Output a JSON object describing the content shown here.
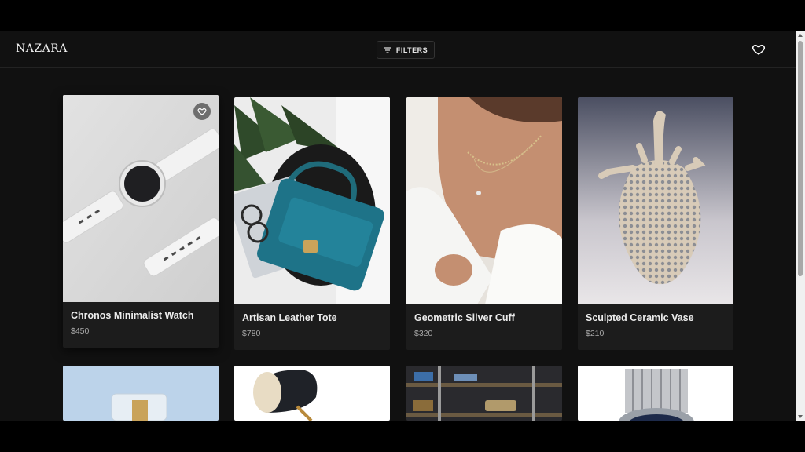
{
  "header": {
    "brand": "NAZARA",
    "filters_label": "FILTERS"
  },
  "products": [
    {
      "name": "Chronos Minimalist Watch",
      "price": "$450",
      "image": "white-smartwatch"
    },
    {
      "name": "Artisan Leather Tote",
      "price": "$780",
      "image": "teal-leather-handbag"
    },
    {
      "name": "Geometric Silver Cuff",
      "price": "$320",
      "image": "necklace-model"
    },
    {
      "name": "Sculpted Ceramic Vase",
      "price": "$210",
      "image": "ceramic-vase"
    }
  ],
  "products_row2": [
    {
      "image": "perfume-bottle"
    },
    {
      "image": "black-lamp"
    },
    {
      "image": "closet-shelves"
    },
    {
      "image": "silver-wristwatch"
    }
  ],
  "colors": {
    "background": "#111111",
    "card": "#1c1c1c",
    "text": "#ececec",
    "price": "#a9a9a9"
  }
}
